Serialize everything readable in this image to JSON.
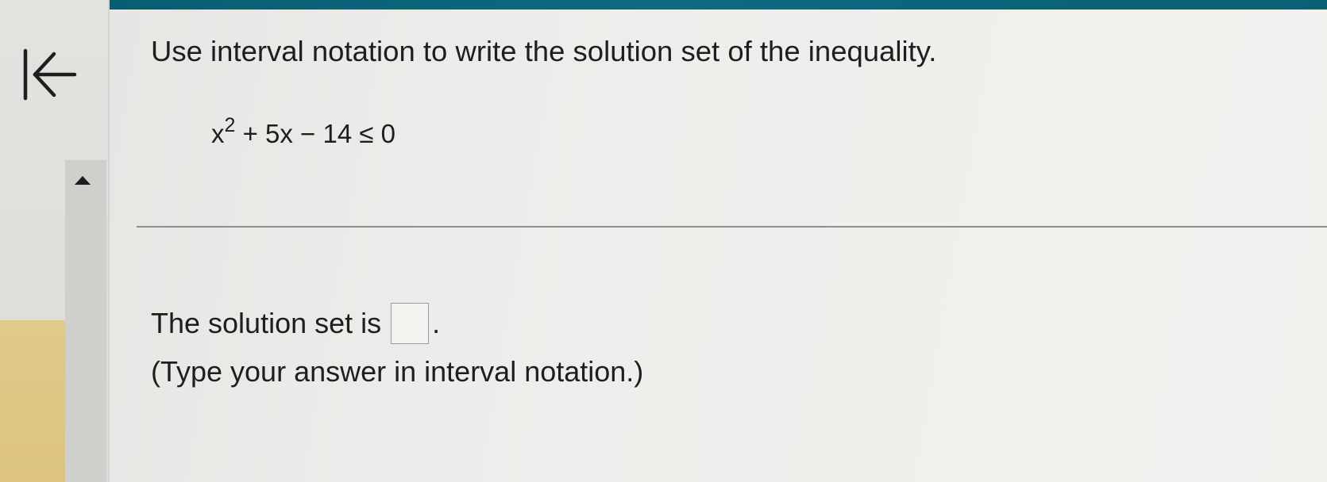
{
  "question": {
    "instruction": "Use interval notation to write the solution set of the inequality.",
    "equation": {
      "base": "x",
      "exponent": "2",
      "rest": " + 5x − 14 ≤ 0"
    }
  },
  "answer": {
    "prefix": "The solution set is",
    "suffix": ".",
    "value": "",
    "hint": "(Type your answer in interval notation.)"
  },
  "icons": {
    "back": "back-to-start-icon",
    "scroll_up": "scroll-up-icon"
  },
  "colors": {
    "top_bar": "#0d6a80",
    "progress_tab": "#dcc47f"
  }
}
